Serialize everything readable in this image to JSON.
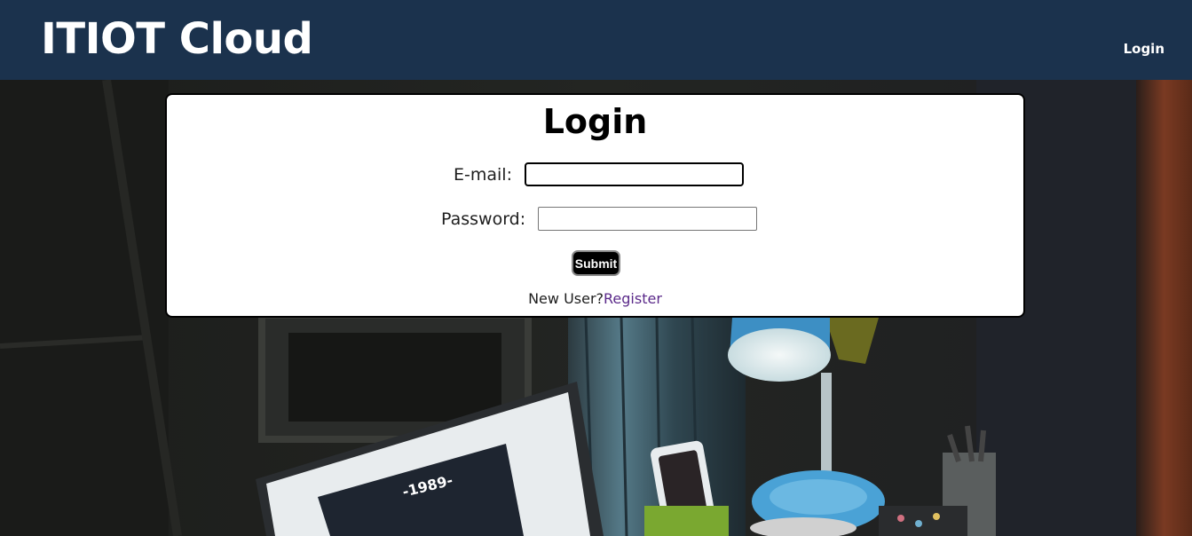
{
  "navbar": {
    "brand": "ITIOT Cloud",
    "login_link": "Login"
  },
  "form": {
    "title": "Login",
    "email_label": "E-mail:",
    "email_value": "",
    "password_label": "Password:",
    "password_value": "",
    "submit_label": "Submit",
    "new_user_text": "New User?",
    "register_link": "Register"
  },
  "colors": {
    "navbar_bg": "#1b324d",
    "register_link": "#5b2a8a"
  }
}
